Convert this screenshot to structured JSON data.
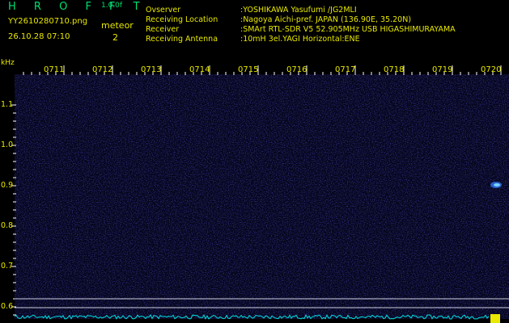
{
  "app": {
    "title": "H R O F F T",
    "version": "1.0.0f",
    "filename": "YY2610280710.png",
    "datetime": "26.10.28 07:10",
    "meteor_label": "meteor",
    "meteor_count": "2"
  },
  "info": [
    {
      "key": "Ovserver",
      "value": ":YOSHIKAWA Yasufumi /JG2MLI"
    },
    {
      "key": "Receiving Location",
      "value": ":Nagoya Aichi-pref. JAPAN (136.90E, 35.20N)"
    },
    {
      "key": "Receiver",
      "value": ":SMArt RTL-SDR V5 52.905MHz USB HIGASHIMURAYAMA"
    },
    {
      "key": "Receiving Antenna",
      "value": ":10mH 3el.YAGI Horizontal:ENE"
    }
  ],
  "axis": {
    "unit": "kHz",
    "time_ticks": [
      "0711",
      "0712",
      "0713",
      "0714",
      "0715",
      "0716",
      "0717",
      "0718",
      "0719",
      "0720"
    ],
    "freq_ticks": [
      "1.1",
      "1.0",
      "0.9",
      "0.8",
      "0.7",
      "0.6"
    ]
  },
  "colors": {
    "background": "#000000",
    "noise": "#1a1aa0",
    "text_yellow": "#e8e800",
    "text_green": "#00e070",
    "scale_cyan": "#00e0e0"
  }
}
